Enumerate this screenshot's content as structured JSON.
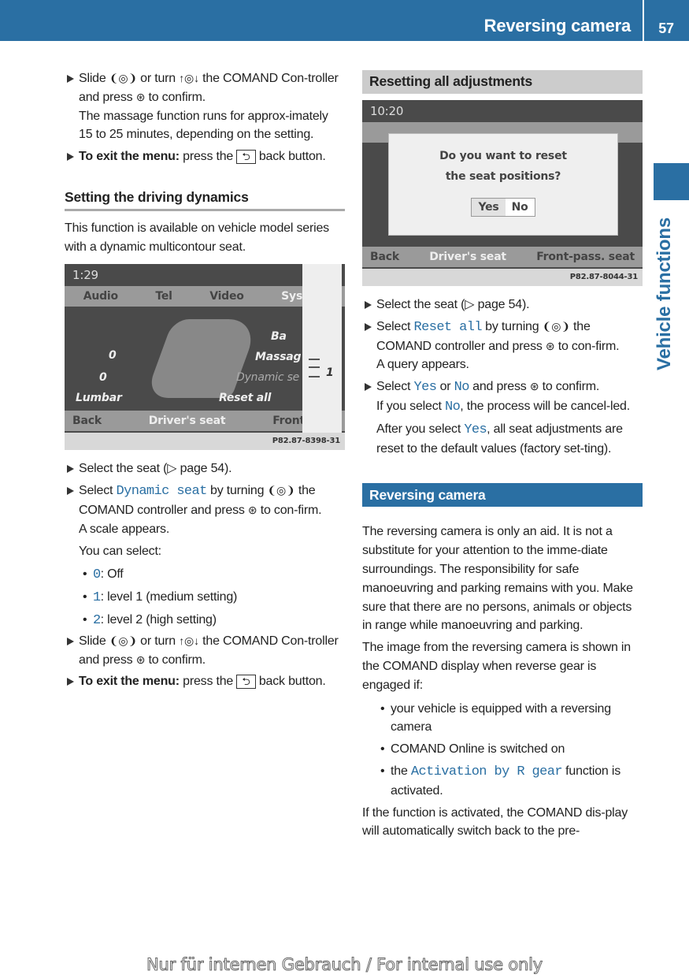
{
  "header": {
    "title": "Reversing camera",
    "page": "57"
  },
  "side_tab": {
    "label": "Vehicle functions"
  },
  "left": [
    {
      "t": "step",
      "s": [
        [
          "",
          "Slide "
        ],
        [
          "icon",
          "❨◎❩",
          "slide-controller-icon"
        ],
        [
          "",
          " or turn "
        ],
        [
          "icon",
          "↑◎↓",
          "turn-controller-icon"
        ],
        [
          "",
          " the COMAND Con-troller and press "
        ],
        [
          "icon",
          "⊛",
          "press-controller-icon"
        ],
        [
          "",
          " to confirm."
        ]
      ]
    },
    {
      "t": "ind",
      "s": [
        [
          "",
          "The massage function runs for approx-imately 15 to 25 minutes, depending on the setting."
        ]
      ]
    },
    {
      "t": "step",
      "m": 4,
      "s": [
        [
          "b",
          "To exit the menu:"
        ],
        [
          "",
          " press the "
        ],
        [
          "key",
          "⮌",
          "back-button-icon"
        ],
        [
          "",
          " back button."
        ]
      ]
    },
    {
      "t": "h",
      "m": 28,
      "s": [
        [
          "",
          "Setting the driving dynamics"
        ]
      ]
    },
    {
      "t": "p",
      "m": 10,
      "s": [
        [
          "",
          "This function is available on vehicle model series with a dynamic multicontour seat."
        ]
      ]
    },
    {
      "t": "fig1",
      "m": 10
    },
    {
      "t": "step",
      "m": 12,
      "s": [
        [
          "",
          "Select the seat (▷ page 54)."
        ]
      ]
    },
    {
      "t": "step",
      "m": 4,
      "s": [
        [
          "",
          "Select "
        ],
        [
          "mono",
          "Dynamic seat"
        ],
        [
          "",
          " by turning "
        ],
        [
          "icon",
          "❨◎❩",
          "turn-controller-icon"
        ],
        [
          "",
          " the COMAND controller and press "
        ],
        [
          "icon",
          "⊛",
          "press-controller-icon"
        ],
        [
          "",
          " to con-firm."
        ]
      ]
    },
    {
      "t": "ind",
      "s": [
        [
          "",
          "A scale appears."
        ]
      ]
    },
    {
      "t": "ind",
      "m": 4,
      "s": [
        [
          "",
          "You can select:"
        ]
      ]
    },
    {
      "t": "bul",
      "m": 6,
      "s": [
        [
          "mono",
          "0"
        ],
        [
          "",
          ": Off"
        ]
      ]
    },
    {
      "t": "bul",
      "m": 4,
      "s": [
        [
          "mono",
          "1"
        ],
        [
          "",
          ": level 1 (medium setting)"
        ]
      ]
    },
    {
      "t": "bul",
      "m": 4,
      "s": [
        [
          "mono",
          "2"
        ],
        [
          "",
          ": level 2 (high setting)"
        ]
      ]
    },
    {
      "t": "step",
      "m": 2,
      "s": [
        [
          "",
          "Slide "
        ],
        [
          "icon",
          "❨◎❩",
          "slide-controller-icon"
        ],
        [
          "",
          " or turn "
        ],
        [
          "icon",
          "↑◎↓",
          "turn-controller-icon"
        ],
        [
          "",
          " the COMAND Con-troller and press "
        ],
        [
          "icon",
          "⊛",
          "press-controller-icon"
        ],
        [
          "",
          " to confirm."
        ]
      ]
    },
    {
      "t": "step",
      "m": 4,
      "s": [
        [
          "b",
          "To exit the menu:"
        ],
        [
          "",
          " press the "
        ],
        [
          "key",
          "⮌",
          "back-button-icon"
        ],
        [
          "",
          " back button."
        ]
      ]
    }
  ],
  "right": [
    {
      "t": "grey",
      "s": [
        [
          "",
          "Resetting all adjustments"
        ]
      ]
    },
    {
      "t": "fig2",
      "m": 8
    },
    {
      "t": "step",
      "m": 12,
      "s": [
        [
          "",
          "Select the seat (▷ page 54)."
        ]
      ]
    },
    {
      "t": "step",
      "m": 4,
      "s": [
        [
          "",
          "Select "
        ],
        [
          "mono",
          "Reset all"
        ],
        [
          "",
          " by turning "
        ],
        [
          "icon",
          "❨◎❩",
          "turn-controller-icon"
        ],
        [
          "",
          " the COMAND controller and press "
        ],
        [
          "icon",
          "⊛",
          "press-controller-icon"
        ],
        [
          "",
          " to con-firm."
        ]
      ]
    },
    {
      "t": "ind",
      "s": [
        [
          "",
          "A query appears."
        ]
      ]
    },
    {
      "t": "step",
      "m": 4,
      "s": [
        [
          "",
          "Select "
        ],
        [
          "mono",
          "Yes"
        ],
        [
          "",
          " or "
        ],
        [
          "mono",
          "No"
        ],
        [
          "",
          " and press "
        ],
        [
          "icon",
          "⊛",
          "press-controller-icon"
        ],
        [
          "",
          " to confirm."
        ]
      ]
    },
    {
      "t": "ind",
      "s": [
        [
          "",
          "If you select "
        ],
        [
          "mono",
          "No"
        ],
        [
          "",
          ", the process will be cancel-led."
        ]
      ]
    },
    {
      "t": "ind",
      "m": 4,
      "s": [
        [
          "",
          "After you select "
        ],
        [
          "mono",
          "Yes"
        ],
        [
          "",
          ", all seat adjustments are reset to the default values (factory set-ting)."
        ]
      ]
    },
    {
      "t": "blue",
      "m": 32,
      "s": [
        [
          "",
          "Reversing camera"
        ]
      ]
    },
    {
      "t": "p",
      "m": 20,
      "s": [
        [
          "",
          "The reversing camera is only an aid. It is not a substitute for your attention to the imme-diate surroundings. The responsibility for safe manoeuvring and parking remains with you. Make sure that there are no persons, animals or objects in range while manoeuvring and parking."
        ]
      ]
    },
    {
      "t": "p",
      "m": 4,
      "s": [
        [
          "",
          "The image from the reversing camera is shown in the COMAND display when reverse gear is engaged if:"
        ]
      ]
    },
    {
      "t": "bul2",
      "m": 6,
      "s": [
        [
          "",
          "your vehicle is equipped with a reversing camera"
        ]
      ]
    },
    {
      "t": "bul2",
      "m": 4,
      "s": [
        [
          "",
          "COMAND Online is switched on"
        ]
      ]
    },
    {
      "t": "bul2",
      "m": 4,
      "s": [
        [
          "",
          "the "
        ],
        [
          "mono",
          "Activation by R gear"
        ],
        [
          "",
          " function is activated."
        ]
      ]
    },
    {
      "t": "p",
      "m": 4,
      "s": [
        [
          "",
          "If the function is activated, the COMAND dis-play will automatically switch back to the pre-"
        ]
      ]
    }
  ],
  "figure1": {
    "time": "1:29",
    "tabs": [
      "Audio",
      "Tel",
      "Video",
      "System"
    ],
    "active_tab": "System",
    "items": [
      "Ba",
      "Massag",
      "Dynamic se",
      "Reset all",
      "Lumbar",
      "0",
      "0"
    ],
    "scale_value": "1",
    "bottom": [
      "Back",
      "Driver's seat",
      "Front-pass"
    ],
    "code": "P82.87-8398-31"
  },
  "figure2": {
    "time": "10:20",
    "question": "Do you want to reset the seat positions?",
    "yes": "Yes",
    "no": "No",
    "bottom": [
      "Back",
      "Driver's seat",
      "Front-pass. seat"
    ],
    "code": "P82.87-8044-31"
  },
  "watermark": "Nur für internen Gebrauch / For internal use only",
  "colors": {
    "accent": "#2a6fa3",
    "grey_band": "#cccccc"
  }
}
